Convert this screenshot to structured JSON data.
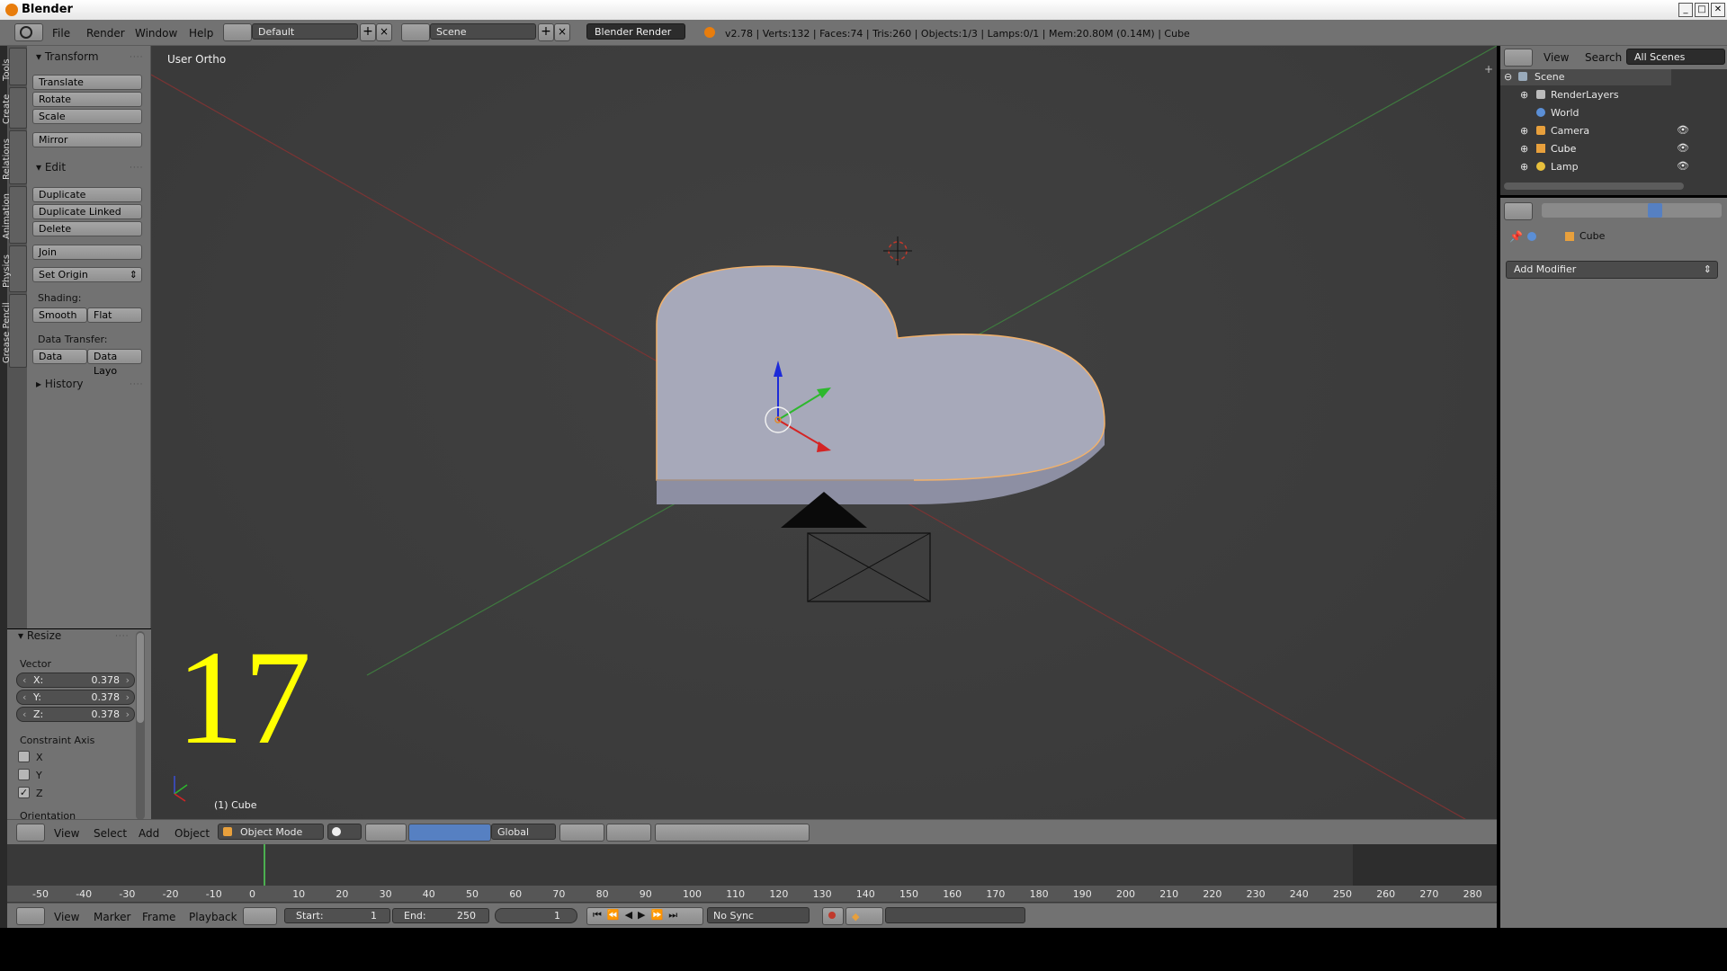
{
  "window": {
    "title": "Blender",
    "controls": [
      "_",
      "□",
      "✕"
    ]
  },
  "info_header": {
    "menus": [
      "File",
      "Render",
      "Window",
      "Help"
    ],
    "layout": "Default",
    "scene": "Scene",
    "engine": "Blender Render",
    "stats": "v2.78 | Verts:132 | Faces:74 | Tris:260 | Objects:1/3 | Lamps:0/1 | Mem:20.80M (0.14M) | Cube"
  },
  "tool_tabs": [
    "Tools",
    "Create",
    "Relations",
    "Animation",
    "Physics",
    "Grease Pencil"
  ],
  "tool_shelf": {
    "transform_title": "Transform",
    "translate": "Translate",
    "rotate": "Rotate",
    "scale": "Scale",
    "mirror": "Mirror",
    "edit_title": "Edit",
    "duplicate": "Duplicate",
    "duplicate_linked": "Duplicate Linked",
    "delete": "Delete",
    "join": "Join",
    "set_origin": "Set Origin",
    "shading_label": "Shading:",
    "smooth": "Smooth",
    "flat": "Flat",
    "data_transfer_label": "Data Transfer:",
    "data": "Data",
    "data_layout": "Data Layo",
    "history_title": "History"
  },
  "redo_panel": {
    "title": "Resize",
    "vector_label": "Vector",
    "x_label": "X:",
    "x_value": "0.378",
    "y_label": "Y:",
    "y_value": "0.378",
    "z_label": "Z:",
    "z_value": "0.378",
    "constraint_label": "Constraint Axis",
    "axis_x": "X",
    "axis_y": "Y",
    "axis_z": "Z",
    "checked": {
      "x": false,
      "y": false,
      "z": true
    },
    "orientation_label": "Orientation"
  },
  "viewport": {
    "view_label": "User Ortho",
    "object_label": "(1) Cube",
    "overlay_number": "17"
  },
  "view3d_header": {
    "menus": [
      "View",
      "Select",
      "Add",
      "Object"
    ],
    "mode": "Object Mode",
    "orientation": "Global"
  },
  "timeline": {
    "ticks": [
      "-50",
      "-40",
      "-30",
      "-20",
      "-10",
      "0",
      "10",
      "20",
      "30",
      "40",
      "50",
      "60",
      "70",
      "80",
      "90",
      "100",
      "110",
      "120",
      "130",
      "140",
      "150",
      "160",
      "170",
      "180",
      "190",
      "200",
      "210",
      "220",
      "230",
      "240",
      "250",
      "260",
      "270",
      "280"
    ],
    "menus": [
      "View",
      "Marker",
      "Frame",
      "Playback"
    ],
    "start_label": "Start:",
    "start_value": "1",
    "end_label": "End:",
    "end_value": "250",
    "current_frame": "1",
    "sync": "No Sync"
  },
  "outliner": {
    "header": {
      "view": "View",
      "search": "Search",
      "filter": "All Scenes"
    },
    "items": [
      "Scene",
      "RenderLayers",
      "World",
      "Camera",
      "Cube",
      "Lamp"
    ]
  },
  "properties": {
    "object_name": "Cube",
    "add_modifier": "Add Modifier"
  },
  "colors": {
    "accent": "#5680c2",
    "selection": "#f1b16b",
    "overlay_number": "#ffff00",
    "heart_face": "#a7a9ba"
  }
}
